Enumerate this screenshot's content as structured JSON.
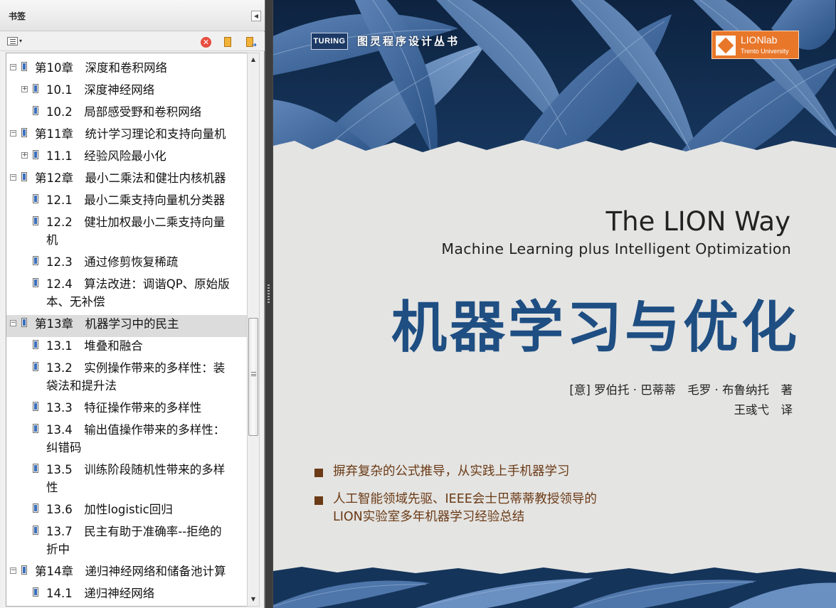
{
  "panel": {
    "title": "书签",
    "collapse_icon": "◀",
    "options_caret": "▾",
    "delete_icon": "✕",
    "toggle_collapsed": "+",
    "toggle_expanded": "−"
  },
  "bookmarks": [
    {
      "text": "第10章　深度和卷积网络",
      "level": 0,
      "toggle": "expanded"
    },
    {
      "text": "10.1　深度神经网络",
      "level": 1,
      "toggle": "collapsed"
    },
    {
      "text": "10.2　局部感受野和卷积网络",
      "level": 1,
      "toggle": "none"
    },
    {
      "text": "第11章　统计学习理论和支持向量机",
      "level": 0,
      "toggle": "expanded"
    },
    {
      "text": "11.1　经验风险最小化",
      "level": 1,
      "toggle": "collapsed"
    },
    {
      "text": "第12章　最小二乘法和健壮内核机器",
      "level": 0,
      "toggle": "expanded"
    },
    {
      "text": "12.1　最小二乘支持向量机分类器",
      "level": 1,
      "toggle": "none"
    },
    {
      "text": "12.2　健壮加权最小二乘支持向量\n机",
      "level": 1,
      "toggle": "none"
    },
    {
      "text": "12.3　通过修剪恢复稀疏",
      "level": 1,
      "toggle": "none"
    },
    {
      "text": "12.4　算法改进：调谐QP、原始版\n本、无补偿",
      "level": 1,
      "toggle": "none"
    },
    {
      "text": "第13章　机器学习中的民主",
      "level": 0,
      "toggle": "expanded",
      "selected": true
    },
    {
      "text": "13.1　堆叠和融合",
      "level": 1,
      "toggle": "none"
    },
    {
      "text": "13.2　实例操作带来的多样性：装\n袋法和提升法",
      "level": 1,
      "toggle": "none"
    },
    {
      "text": "13.3　特征操作带来的多样性",
      "level": 1,
      "toggle": "none"
    },
    {
      "text": "13.4　输出值操作带来的多样性：\n纠错码",
      "level": 1,
      "toggle": "none"
    },
    {
      "text": "13.5　训练阶段随机性带来的多样\n性",
      "level": 1,
      "toggle": "none"
    },
    {
      "text": "13.6　加性logistic回归",
      "level": 1,
      "toggle": "none"
    },
    {
      "text": "13.7　民主有助于准确率--拒绝的\n折中",
      "level": 1,
      "toggle": "none"
    },
    {
      "text": "第14章　递归神经网络和储备池计算",
      "level": 0,
      "toggle": "expanded"
    },
    {
      "text": "14.1　递归神经网络",
      "level": 1,
      "toggle": "none"
    }
  ],
  "scrollbar": {
    "up_icon": "▲",
    "down_icon": "▼"
  },
  "cover": {
    "publisher_logo": "TURING",
    "series": "图灵程序设计丛书",
    "lab_logo_name": "LIONlab",
    "lab_logo_sub": "Trento University",
    "title_en": "The LION Way",
    "subtitle_en": "Machine Learning plus Intelligent Optimization",
    "title_zh": "机器学习与优化",
    "authors": "[意] 罗伯托 · 巴蒂蒂　毛罗 · 布鲁纳托　著",
    "translator": "王彧弋　译",
    "bullets": [
      "摒弃复杂的公式推导，从实践上手机器学习",
      "人工智能领域先驱、IEEE会士巴蒂蒂教授领导的\nLION实验室多年机器学习经验总结"
    ],
    "accent_color": "#1e4e82",
    "bullet_color": "#6b3a16"
  }
}
